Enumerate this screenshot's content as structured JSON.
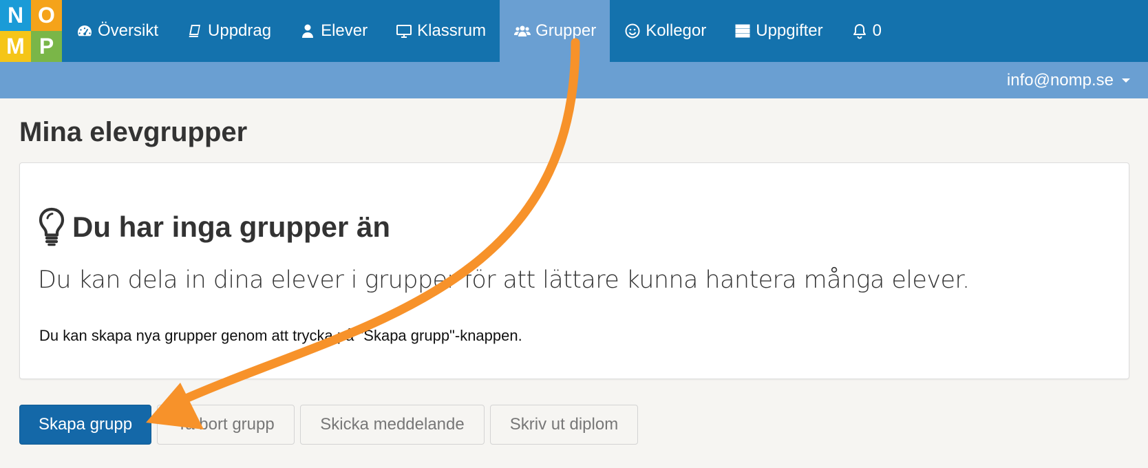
{
  "logo": {
    "letters": [
      "N",
      "O",
      "M",
      "P"
    ],
    "colors": [
      "#1a9bd7",
      "#f5a31a",
      "#f5c518",
      "#7ab648"
    ]
  },
  "nav": {
    "items": [
      {
        "label": "Översikt",
        "icon": "dashboard-icon"
      },
      {
        "label": "Uppdrag",
        "icon": "book-icon"
      },
      {
        "label": "Elever",
        "icon": "user-icon"
      },
      {
        "label": "Klassrum",
        "icon": "monitor-icon"
      },
      {
        "label": "Grupper",
        "icon": "users-icon",
        "active": true
      },
      {
        "label": "Kollegor",
        "icon": "smiley-icon"
      },
      {
        "label": "Uppgifter",
        "icon": "grid-icon"
      },
      {
        "label": "0",
        "icon": "bell-icon"
      }
    ]
  },
  "user": {
    "email": "info@nomp.se"
  },
  "page": {
    "title": "Mina elevgrupper"
  },
  "empty_state": {
    "heading": "Du har inga grupper än",
    "lead": "Du kan dela in dina elever i grupper för att lättare kunna hantera många elever.",
    "hint": "Du kan skapa nya grupper genom att trycka på \"Skapa grupp\"-knappen."
  },
  "buttons": {
    "create": "Skapa grupp",
    "delete": "Ta bort grupp",
    "message": "Skicka meddelande",
    "diploma": "Skriv ut diplom"
  },
  "colors": {
    "navbar": "#1472ad",
    "subbar": "#6a9fd2",
    "primary": "#1468a8",
    "arrow": "#f7922a"
  }
}
